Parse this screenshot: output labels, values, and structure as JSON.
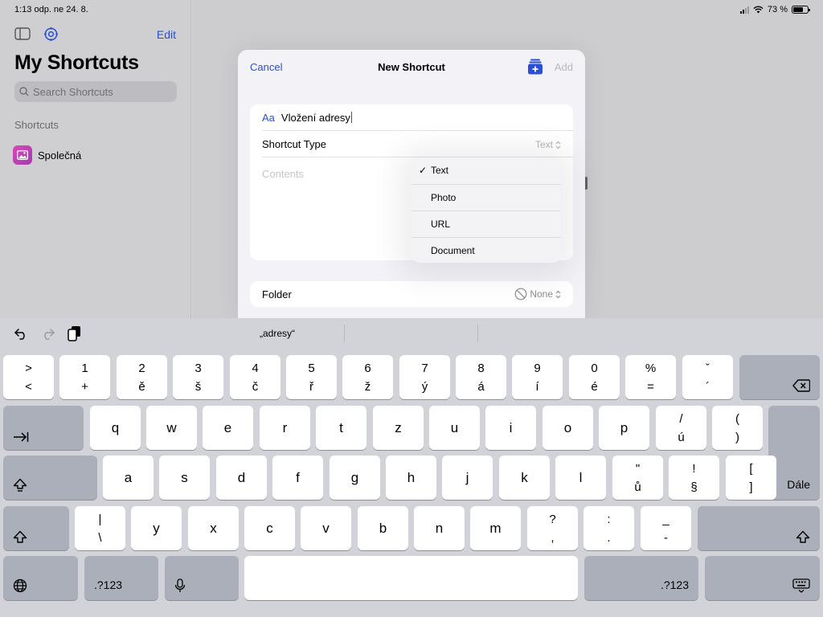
{
  "status_bar": {
    "time": "1:13 odp.  ne 24. 8.",
    "battery": "73 %",
    "battery_level": 0.73
  },
  "sidebar": {
    "edit_label": "Edit",
    "title": "My Shortcuts",
    "search_placeholder": "Search Shortcuts",
    "section_label": "Shortcuts",
    "items": [
      {
        "label": "Společná",
        "icon": "photo-icon"
      }
    ]
  },
  "sheet": {
    "cancel_label": "Cancel",
    "title": "New Shortcut",
    "add_label": "Add",
    "name_prefix": "Aa",
    "name_value": "Vložení adresy",
    "type_label": "Shortcut Type",
    "type_value": "Text",
    "contents_placeholder": "Contents",
    "folder_label": "Folder",
    "folder_value": "None"
  },
  "type_menu": {
    "options": [
      "Text",
      "Photo",
      "URL",
      "Document"
    ],
    "selected_index": 0
  },
  "keyboard": {
    "suggestions": [
      "„adresy“",
      "",
      ""
    ],
    "row1": [
      {
        "top": ">",
        "bot": "<"
      },
      {
        "top": "1",
        "bot": "+"
      },
      {
        "top": "2",
        "bot": "ě"
      },
      {
        "top": "3",
        "bot": "š"
      },
      {
        "top": "4",
        "bot": "č"
      },
      {
        "top": "5",
        "bot": "ř"
      },
      {
        "top": "6",
        "bot": "ž"
      },
      {
        "top": "7",
        "bot": "ý"
      },
      {
        "top": "8",
        "bot": "á"
      },
      {
        "top": "9",
        "bot": "í"
      },
      {
        "top": "0",
        "bot": "é"
      },
      {
        "top": "%",
        "bot": "="
      },
      {
        "top": "ˇ",
        "bot": "´"
      }
    ],
    "row2": [
      {
        "lbl": "q"
      },
      {
        "lbl": "w"
      },
      {
        "lbl": "e"
      },
      {
        "lbl": "r"
      },
      {
        "lbl": "t"
      },
      {
        "lbl": "z"
      },
      {
        "lbl": "u"
      },
      {
        "lbl": "i"
      },
      {
        "lbl": "o"
      },
      {
        "lbl": "p"
      },
      {
        "top": "/",
        "bot": "ú"
      },
      {
        "top": "(",
        "bot": ")"
      }
    ],
    "row3": [
      {
        "lbl": "a"
      },
      {
        "lbl": "s"
      },
      {
        "lbl": "d"
      },
      {
        "lbl": "f"
      },
      {
        "lbl": "g"
      },
      {
        "lbl": "h"
      },
      {
        "lbl": "j"
      },
      {
        "lbl": "k"
      },
      {
        "lbl": "l"
      },
      {
        "top": "\"",
        "bot": "ů"
      },
      {
        "top": "!",
        "bot": "§"
      },
      {
        "top": "[",
        "bot": "]"
      }
    ],
    "row4": [
      {
        "top": "|",
        "bot": "\\"
      },
      {
        "lbl": "y"
      },
      {
        "lbl": "x"
      },
      {
        "lbl": "c"
      },
      {
        "lbl": "v"
      },
      {
        "lbl": "b"
      },
      {
        "lbl": "n"
      },
      {
        "lbl": "m"
      },
      {
        "top": "?",
        "bot": ","
      },
      {
        "top": ":",
        "bot": "."
      },
      {
        "top": "_",
        "bot": "-"
      }
    ],
    "return_label": "Dále",
    "numbers_label": ".?123"
  }
}
